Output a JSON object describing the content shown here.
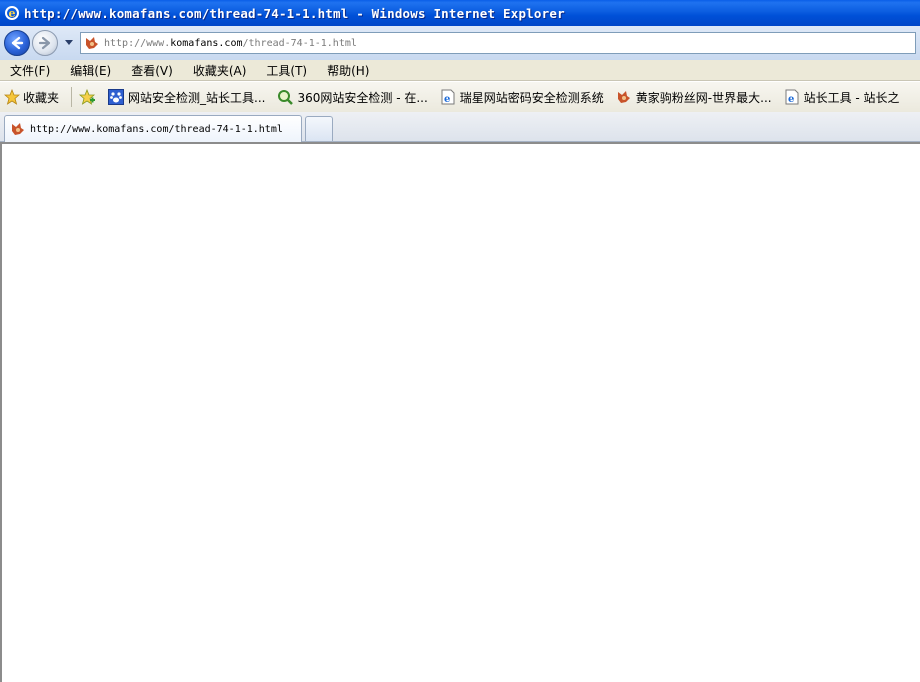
{
  "window": {
    "title": "http://www.komafans.com/thread-74-1-1.html - Windows Internet Explorer"
  },
  "address": {
    "url_prefix": "http://www.",
    "url_host": "komafans.com",
    "url_path": "/thread-74-1-1.html"
  },
  "menu": {
    "items": [
      "文件(F)",
      "编辑(E)",
      "查看(V)",
      "收藏夹(A)",
      "工具(T)",
      "帮助(H)"
    ]
  },
  "favorites": {
    "label": "收藏夹",
    "items": [
      {
        "label": "网站安全检测_站长工具...",
        "icon": "paw-icon"
      },
      {
        "label": "360网站安全检测 - 在...",
        "icon": "magnifier-icon"
      },
      {
        "label": "瑞星网站密码安全检测系统",
        "icon": "ie-page-icon"
      },
      {
        "label": "黄家驹粉丝网-世界最大...",
        "icon": "fox-icon"
      },
      {
        "label": "站长工具 - 站长之",
        "icon": "ie-page-icon"
      }
    ]
  },
  "tabs": {
    "active_label": "http://www.komafans.com/thread-74-1-1.html"
  },
  "colors": {
    "titlebar": "#0054e3",
    "menubar": "#ece9d8"
  }
}
